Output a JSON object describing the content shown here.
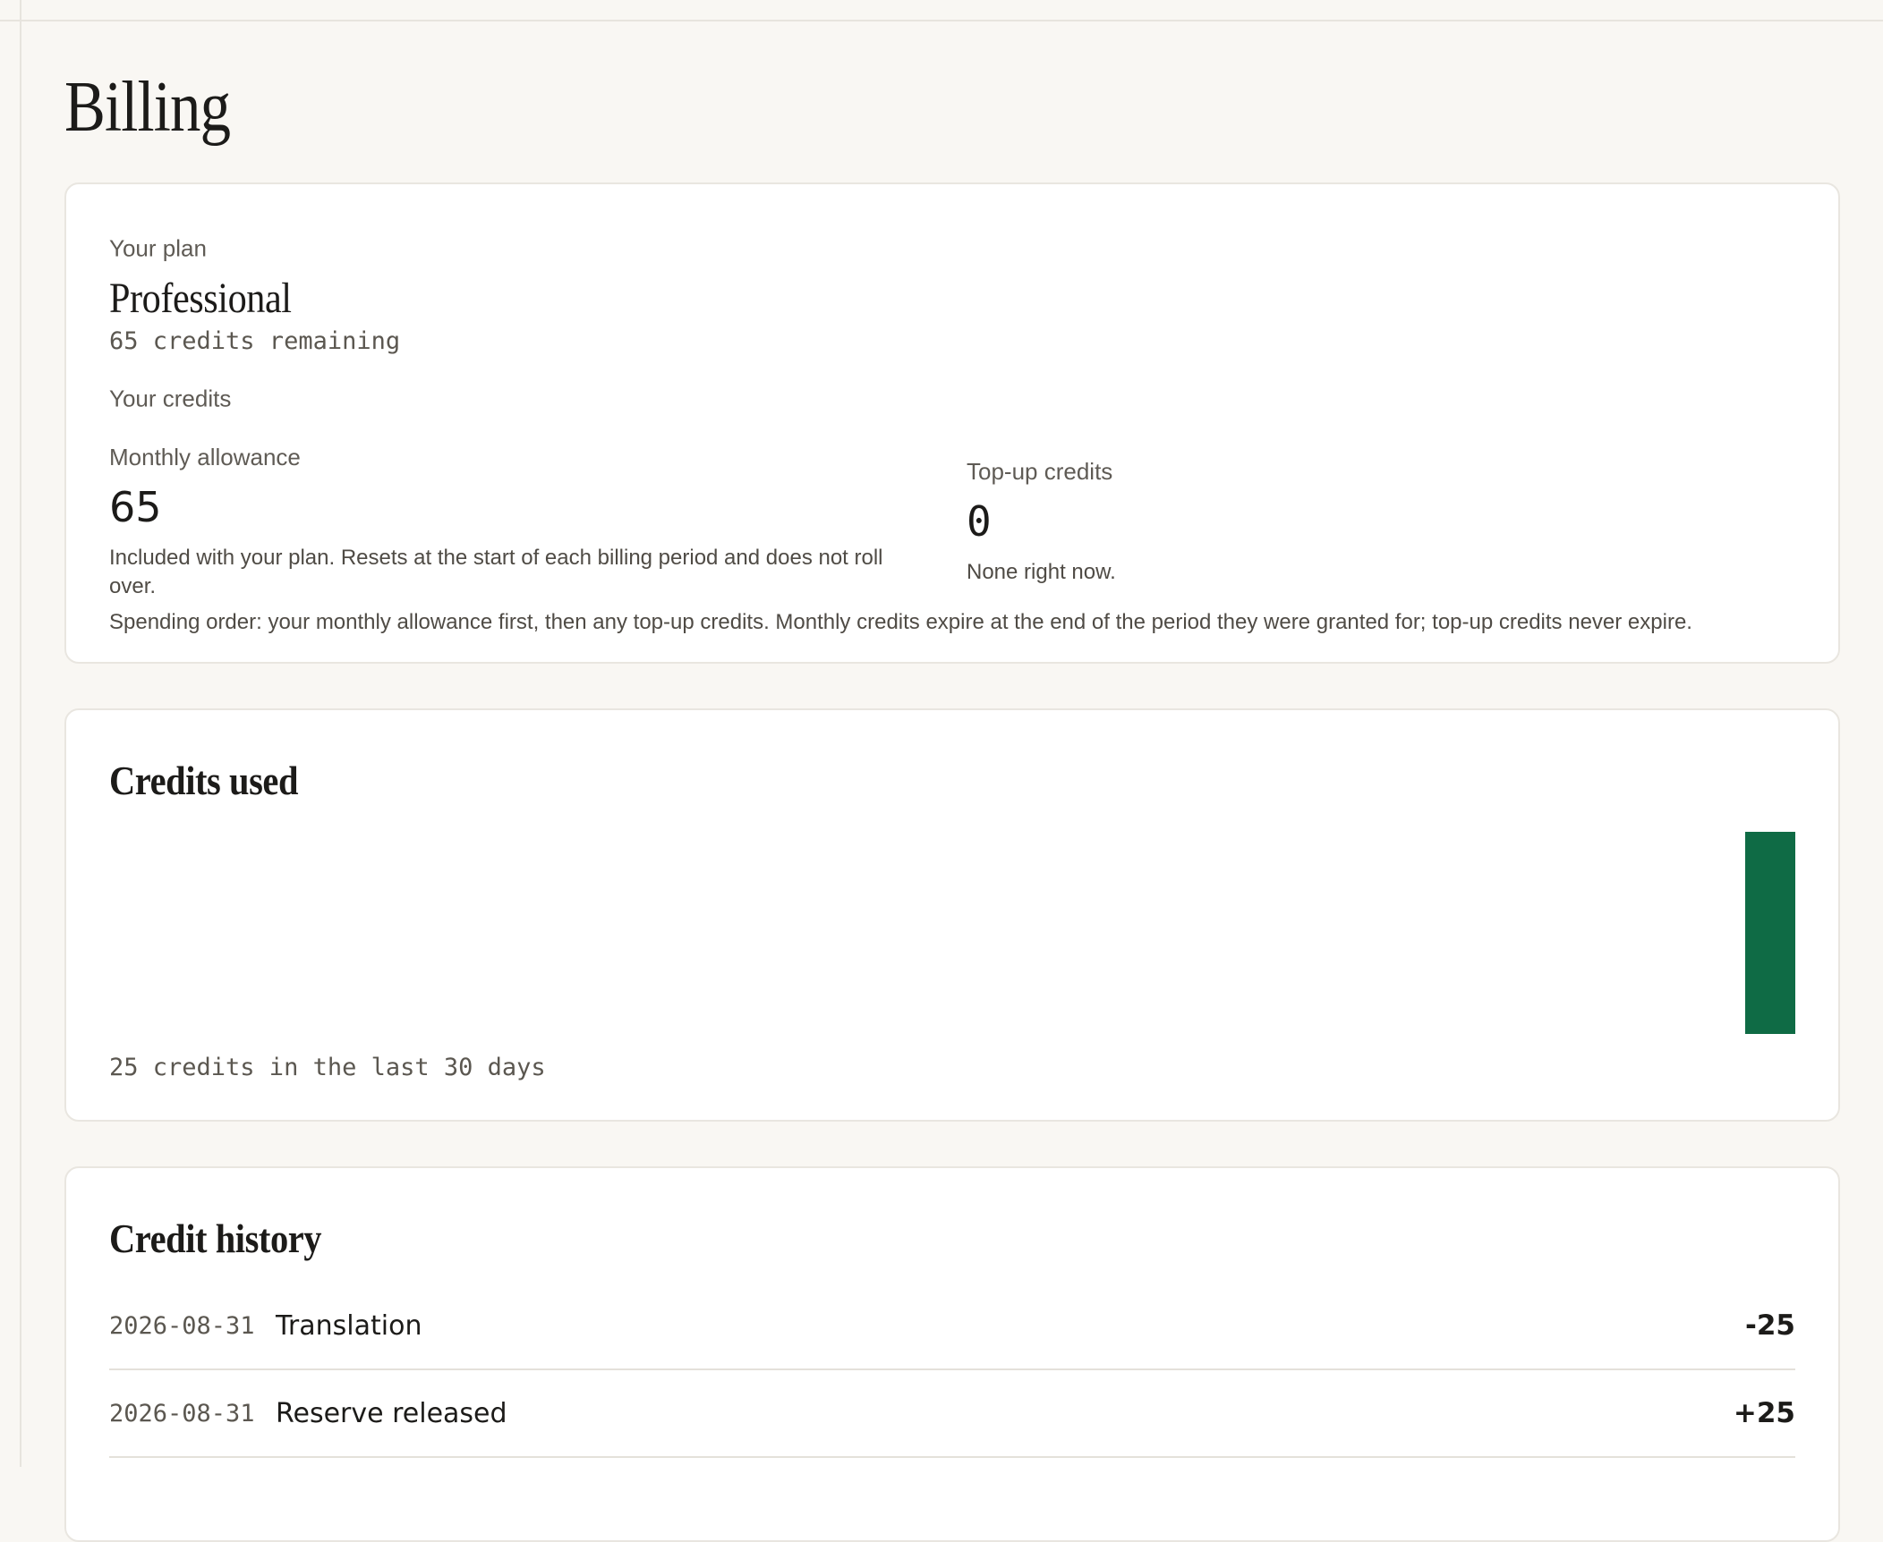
{
  "page": {
    "title": "Billing"
  },
  "plan": {
    "label": "Your plan",
    "name": "Professional",
    "remaining": "65 credits remaining",
    "credits_label": "Your credits",
    "monthly": {
      "label": "Monthly allowance",
      "value": "65",
      "description": "Included with your plan. Resets at the start of each billing period and does not roll over."
    },
    "topup": {
      "label": "Top-up credits",
      "value": "0",
      "description": "None right now."
    },
    "spending_order": "Spending order: your monthly allowance first, then any top-up credits. Monthly credits expire at the end of the period they were granted for; top-up credits never expire."
  },
  "usage": {
    "title": "Credits used",
    "summary": "25 credits in the last 30 days",
    "bar_color": "#0f6b45",
    "chart_data": {
      "type": "bar",
      "days": 30,
      "values": [
        0,
        0,
        0,
        0,
        0,
        0,
        0,
        0,
        0,
        0,
        0,
        0,
        0,
        0,
        0,
        0,
        0,
        0,
        0,
        0,
        0,
        0,
        0,
        0,
        0,
        0,
        0,
        0,
        0,
        0,
        0,
        0,
        0,
        0,
        25
      ],
      "ylim": [
        0,
        25
      ]
    }
  },
  "history": {
    "title": "Credit history",
    "rows": [
      {
        "date": "2026-08-31",
        "description": "Translation",
        "amount": "-25"
      },
      {
        "date": "2026-08-31",
        "description": "Reserve released",
        "amount": "+25"
      }
    ]
  }
}
